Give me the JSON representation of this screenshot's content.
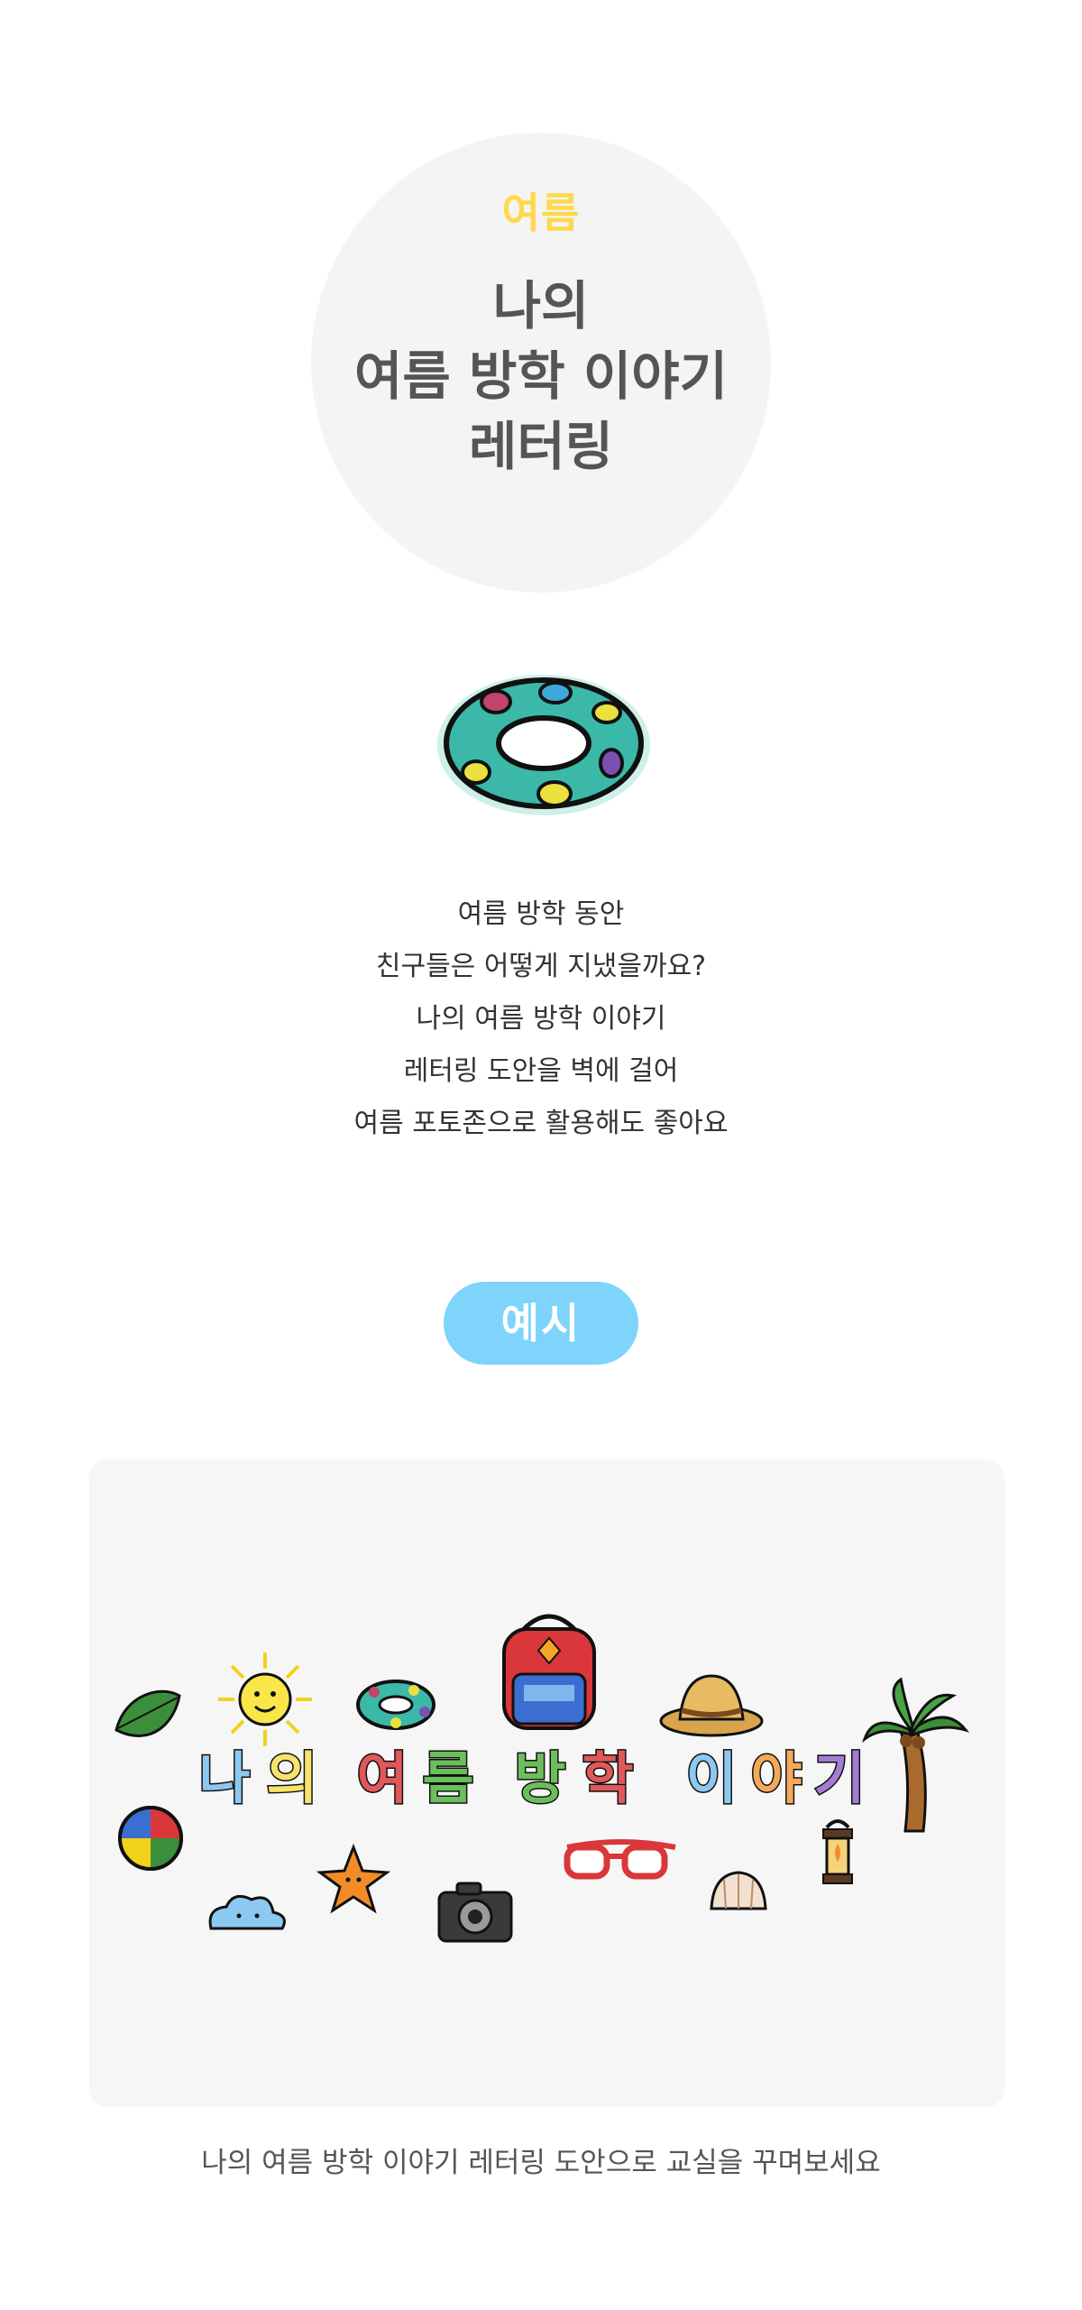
{
  "hero": {
    "kicker": "여름",
    "title_lines": [
      "나의",
      "여름 방학 이야기",
      "레터링"
    ]
  },
  "intro": {
    "lines": [
      "여름 방학 동안",
      "친구들은 어떻게 지냈을까요?",
      "나의 여름 방학 이야기",
      "레터링 도안을 벽에 걸어",
      "여름 포토존으로 활용해도 좋아요"
    ]
  },
  "example": {
    "badge_label": "예시",
    "lettering": [
      "나",
      "의",
      "여",
      "름",
      "방",
      "학",
      "이",
      "야",
      "기"
    ]
  },
  "caption": "나의 여름 방학 이야기 레터링 도안으로 교실을 꾸며보세요",
  "colors": {
    "kicker": "#ffd84a",
    "title": "#555555",
    "badge": "#7fd4fb",
    "card_bg": "#f6f6f6",
    "circle_bg": "#f4f4f4"
  },
  "icons": [
    "swim-ring-icon",
    "leaf-icon",
    "sun-icon",
    "backpack-icon",
    "straw-hat-icon",
    "palm-tree-icon",
    "beach-ball-icon",
    "starfish-icon",
    "cloud-icon",
    "camera-icon",
    "sunglasses-icon",
    "seashell-icon",
    "lantern-icon"
  ]
}
